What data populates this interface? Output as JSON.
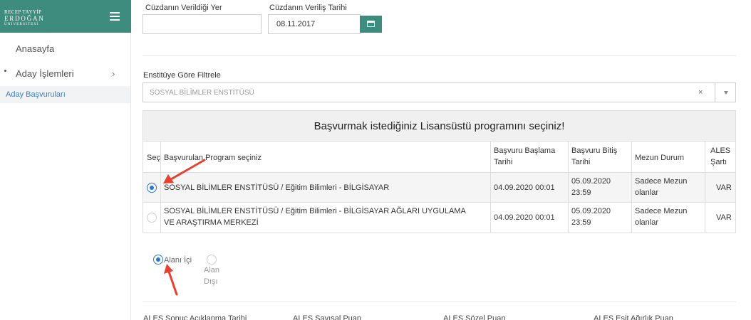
{
  "brand": {
    "line1": "RECEP TAYYİP",
    "line2": "ERDOĞAN",
    "line3": "ÜNİVERSİTESİ"
  },
  "sidebar": {
    "home": "Anasayfa",
    "aday": "Aday İşlemleri",
    "chevron": "›",
    "sub_item": "Aday Başvuruları"
  },
  "form": {
    "cuzdan_yer_label": "Cüzdanın Verildiği Yer",
    "cuzdan_yer_value": "",
    "cuzdan_tarih_label": "Cüzdanın Veriliş Tarihi",
    "cuzdan_tarih_value": "08.11.2017",
    "filter_label": "Enstitüye Göre Filtrele",
    "filter_value": "SOSYAL BİLİMLER ENSTİTÜSÜ",
    "filter_clear": "×"
  },
  "table": {
    "title": "Başvurmak istediğiniz Lisansüstü programını seçiniz!",
    "headers": {
      "sec": "Seç",
      "program": "Başvurulan Program seçiniz",
      "baslama": "Başvuru Başlama Tarihi",
      "bitis": "Başvuru Bitiş Tarihi",
      "mezun": "Mezun Durum",
      "ales": "ALES Şartı"
    },
    "rows": [
      {
        "selected": true,
        "program": "SOSYAL BİLİMLER ENSTİTÜSÜ / Eğitim Bilimleri - BİLGİSAYAR",
        "baslama": "04.09.2020 00:01",
        "bitis": "05.09.2020 23:59",
        "mezun": "Sadece Mezun olanlar",
        "ales": "VAR"
      },
      {
        "selected": false,
        "program": "SOSYAL BİLİMLER ENSTİTÜSÜ / Eğitim Bilimleri - BİLGİSAYAR AĞLARI UYGULAMA VE ARAŞTIRMA MERKEZİ",
        "baslama": "04.09.2020 00:01",
        "bitis": "05.09.2020 23:59",
        "mezun": "Sadece Mezun olanlar",
        "ales": "VAR"
      }
    ]
  },
  "alan": {
    "ici": "Alanı İçi",
    "disi": "Alan Dışı",
    "selected": "ici"
  },
  "ales_fields": {
    "tarih": "ALES Sonuç Açıklanma Tarihi",
    "sayisal": "ALES Sayısal Puan",
    "sozel": "ALES Sözel Puan",
    "esit": "ALES Eşit Ağırlık Puan"
  },
  "colors": {
    "brand": "#3d8c7e",
    "radio_selected": "#2a78c5",
    "annotation_arrow": "#e8412f",
    "link": "#3a7fc1"
  }
}
